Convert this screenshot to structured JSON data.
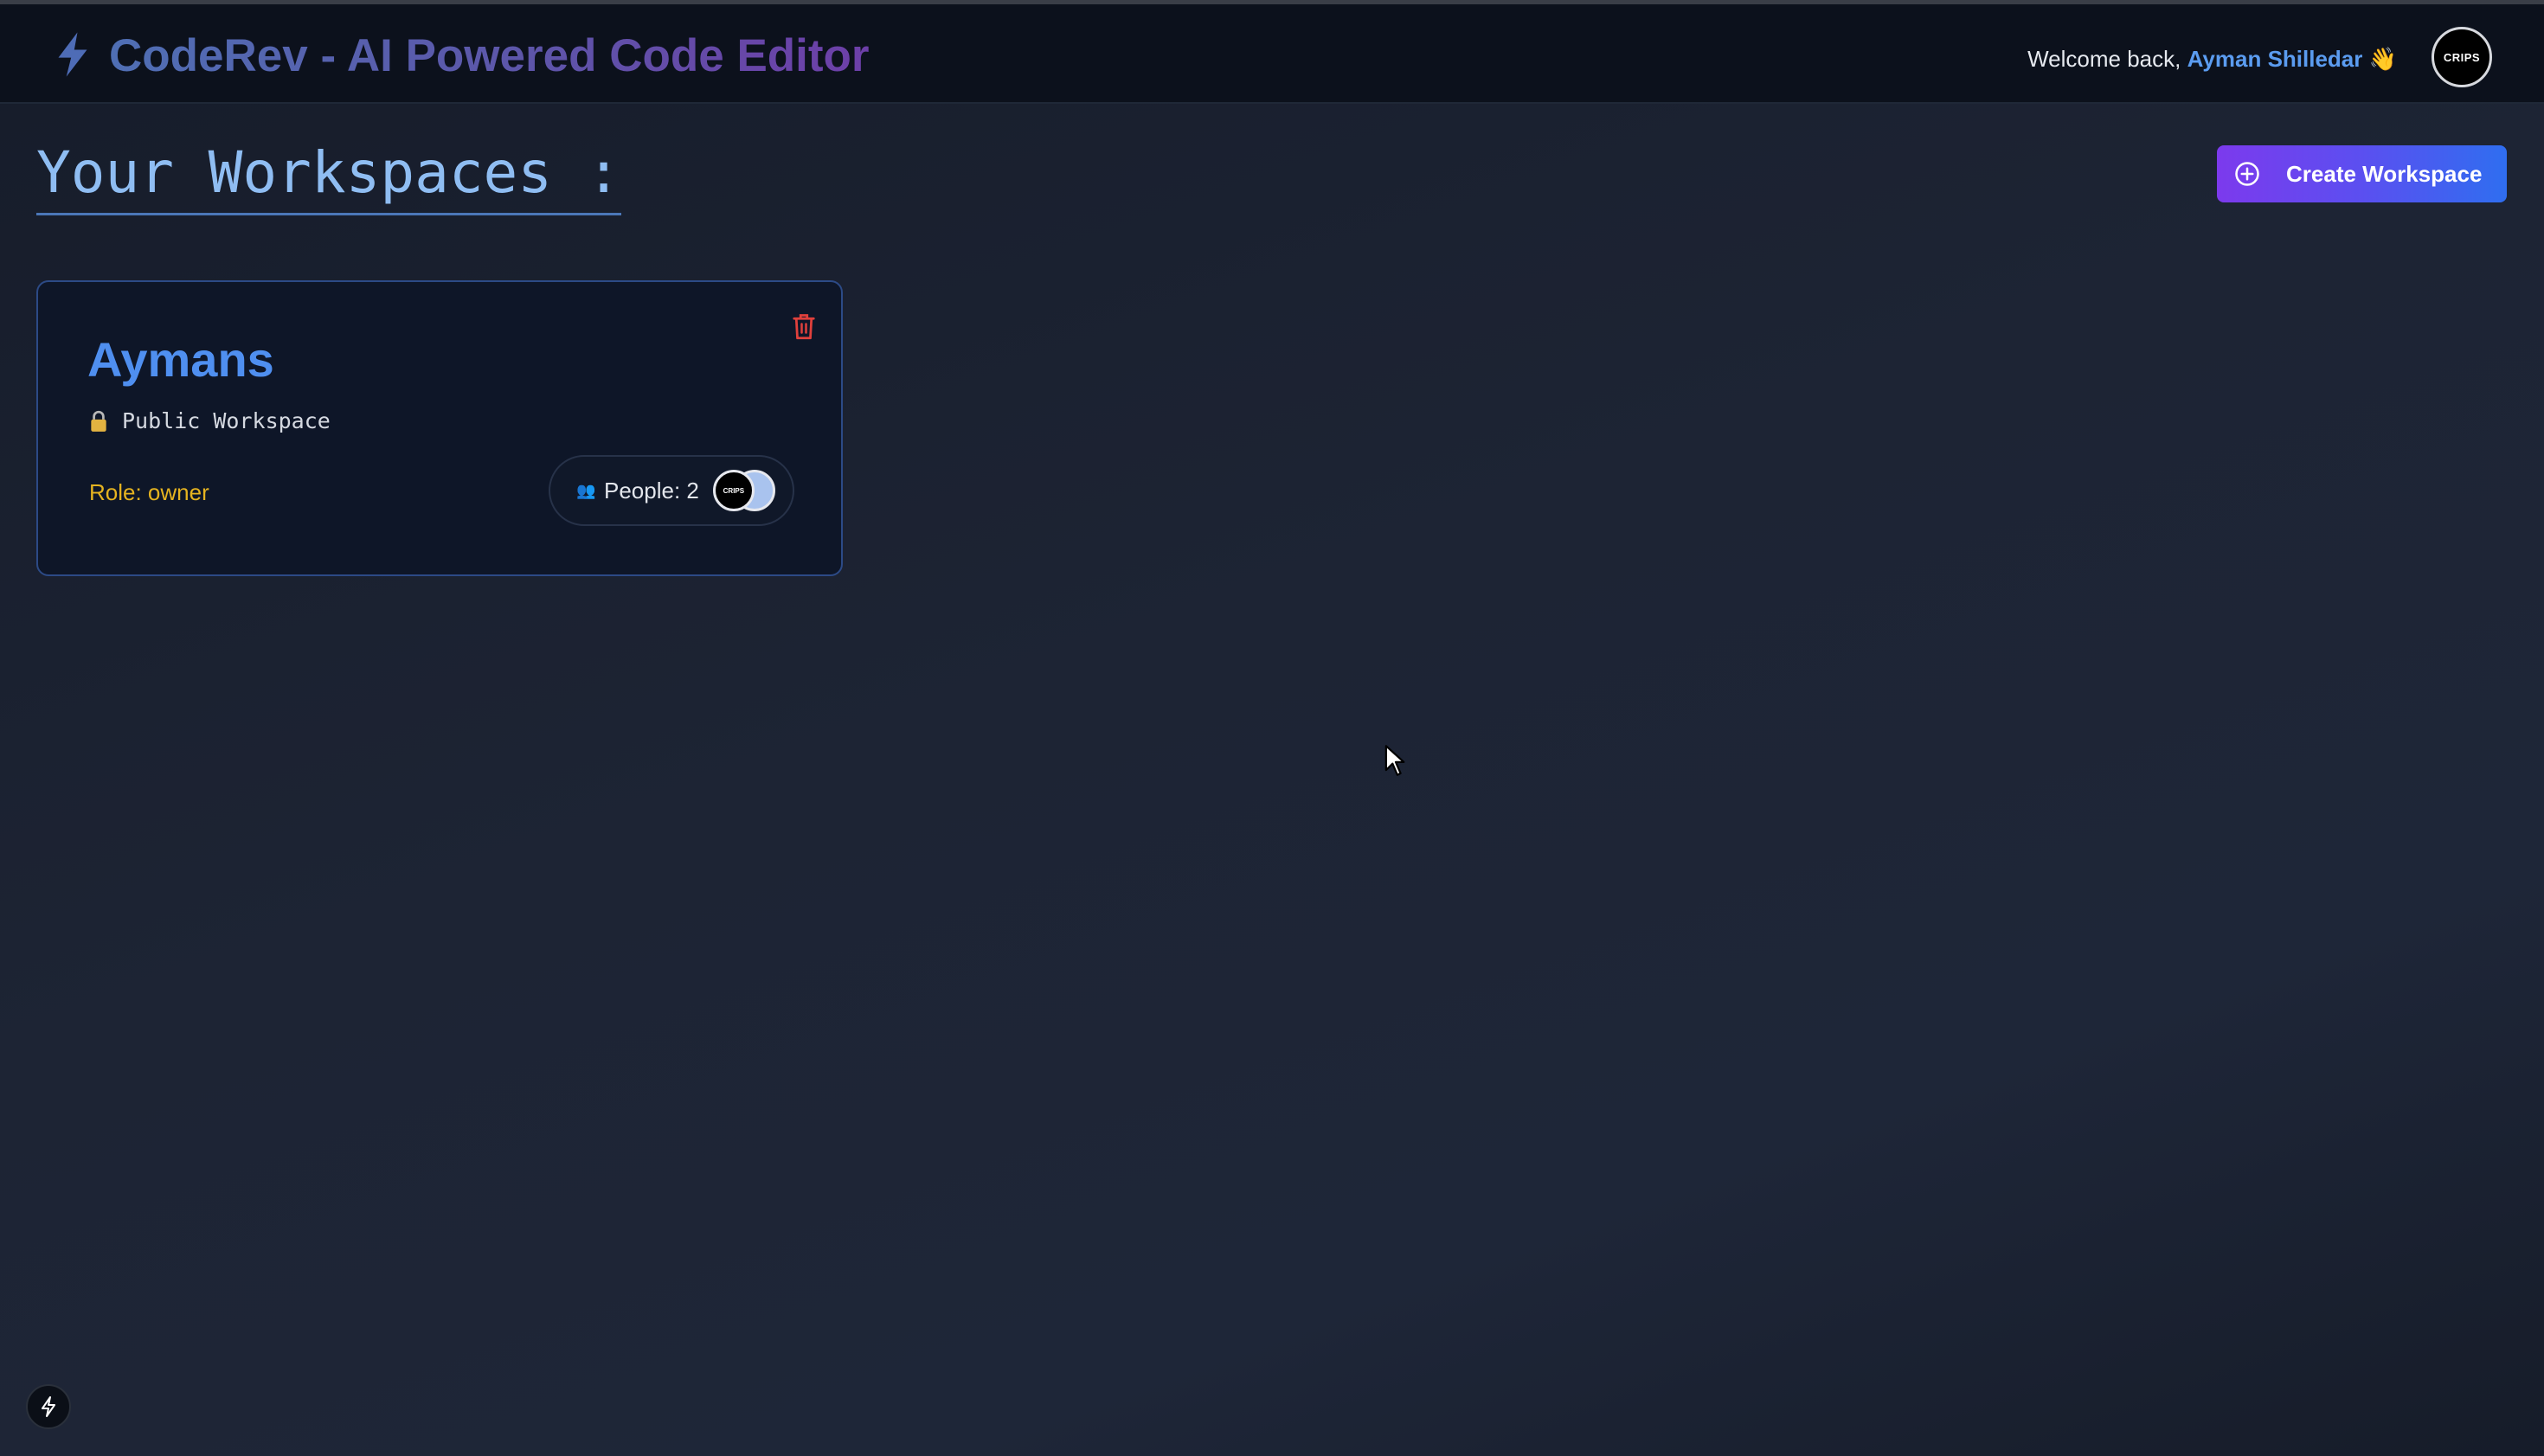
{
  "header": {
    "title": "CodeRev - AI Powered Code Editor",
    "welcome_prefix": "Welcome back,",
    "user_name": "Ayman Shilledar",
    "wave_emoji": "👋",
    "avatar_text": "CRIPS"
  },
  "main": {
    "page_title": "Your Workspaces :",
    "create_button_label": "Create Workspace"
  },
  "workspaces": [
    {
      "name": "Aymans",
      "visibility": "Public Workspace",
      "role": "Role: owner",
      "people": "People: 2",
      "people_emoji": "👥",
      "avatar_text": "CRIPS"
    }
  ],
  "colors": {
    "accent_blue": "#4f8ff0",
    "accent_purple": "#7c3aed",
    "role_yellow": "#e5b320",
    "danger_red": "#e0403c"
  }
}
